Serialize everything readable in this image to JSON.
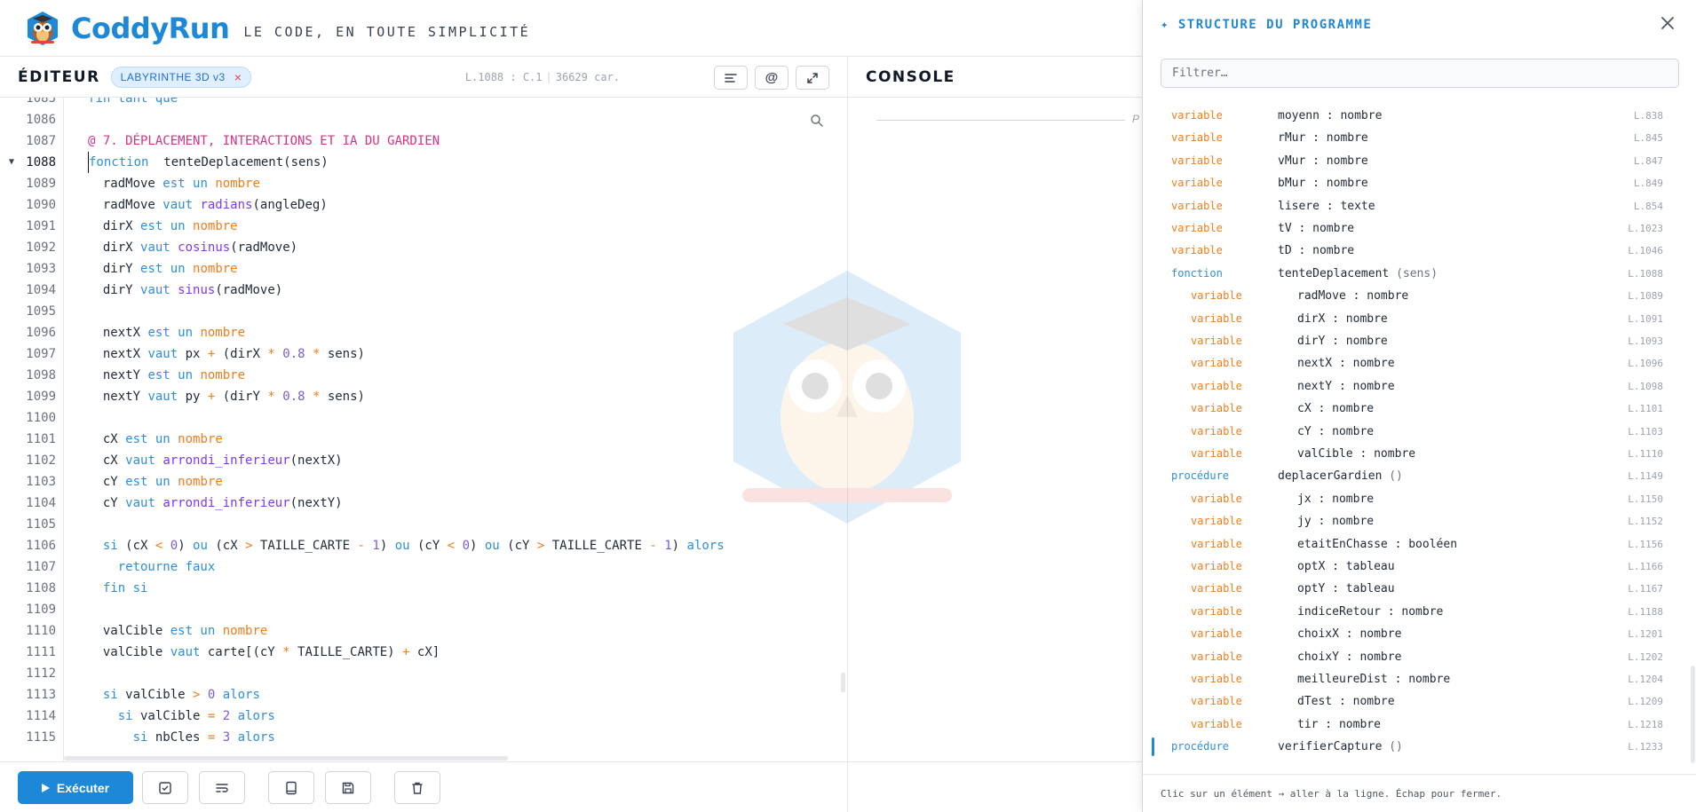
{
  "header": {
    "brand": "CoddyRun",
    "tagline": "LE CODE, EN TOUTE SIMPLICITÉ"
  },
  "editor": {
    "title": "ÉDITEUR",
    "file_tab": "LABYRINTHE 3D v3",
    "cursor_pos": "L.1088 : C.1",
    "char_count": "36629 car.",
    "lines": [
      {
        "n": "1085",
        "tokens": [
          [
            "kw",
            "fin tant que"
          ]
        ]
      },
      {
        "n": "1086",
        "tokens": []
      },
      {
        "n": "1087",
        "tokens": [
          [
            "cmt",
            "@ 7. DÉPLACEMENT, INTERACTIONS ET IA DU GARDIEN"
          ]
        ]
      },
      {
        "n": "1088",
        "active": true,
        "fold": true,
        "tokens": [
          [
            "kw",
            "fonction"
          ],
          [
            "",
            "  "
          ],
          [
            "",
            "tenteDeplacement(sens)"
          ]
        ]
      },
      {
        "n": "1089",
        "tokens": [
          [
            "",
            "  radMove "
          ],
          [
            "kw",
            "est un "
          ],
          [
            "ty",
            "nombre"
          ]
        ]
      },
      {
        "n": "1090",
        "tokens": [
          [
            "",
            "  radMove "
          ],
          [
            "kw",
            "vaut "
          ],
          [
            "fn",
            "radians"
          ],
          [
            "",
            "(angleDeg)"
          ]
        ]
      },
      {
        "n": "1091",
        "tokens": [
          [
            "",
            "  dirX "
          ],
          [
            "kw",
            "est un "
          ],
          [
            "ty",
            "nombre"
          ]
        ]
      },
      {
        "n": "1092",
        "tokens": [
          [
            "",
            "  dirX "
          ],
          [
            "kw",
            "vaut "
          ],
          [
            "fn",
            "cosinus"
          ],
          [
            "",
            "(radMove)"
          ]
        ]
      },
      {
        "n": "1093",
        "tokens": [
          [
            "",
            "  dirY "
          ],
          [
            "kw",
            "est un "
          ],
          [
            "ty",
            "nombre"
          ]
        ]
      },
      {
        "n": "1094",
        "tokens": [
          [
            "",
            "  dirY "
          ],
          [
            "kw",
            "vaut "
          ],
          [
            "fn",
            "sinus"
          ],
          [
            "",
            "(radMove)"
          ]
        ]
      },
      {
        "n": "1095",
        "tokens": []
      },
      {
        "n": "1096",
        "tokens": [
          [
            "",
            "  nextX "
          ],
          [
            "kw",
            "est un "
          ],
          [
            "ty",
            "nombre"
          ]
        ]
      },
      {
        "n": "1097",
        "tokens": [
          [
            "",
            "  nextX "
          ],
          [
            "kw",
            "vaut "
          ],
          [
            "",
            "px "
          ],
          [
            "op",
            "+"
          ],
          [
            "",
            " (dirX "
          ],
          [
            "op",
            "*"
          ],
          [
            "",
            " "
          ],
          [
            "num",
            "0.8"
          ],
          [
            "",
            " "
          ],
          [
            "op",
            "*"
          ],
          [
            "",
            " sens)"
          ]
        ]
      },
      {
        "n": "1098",
        "tokens": [
          [
            "",
            "  nextY "
          ],
          [
            "kw",
            "est un "
          ],
          [
            "ty",
            "nombre"
          ]
        ]
      },
      {
        "n": "1099",
        "tokens": [
          [
            "",
            "  nextY "
          ],
          [
            "kw",
            "vaut "
          ],
          [
            "",
            "py "
          ],
          [
            "op",
            "+"
          ],
          [
            "",
            " (dirY "
          ],
          [
            "op",
            "*"
          ],
          [
            "",
            " "
          ],
          [
            "num",
            "0.8"
          ],
          [
            "",
            " "
          ],
          [
            "op",
            "*"
          ],
          [
            "",
            " sens)"
          ]
        ]
      },
      {
        "n": "1100",
        "tokens": []
      },
      {
        "n": "1101",
        "tokens": [
          [
            "",
            "  cX "
          ],
          [
            "kw",
            "est un "
          ],
          [
            "ty",
            "nombre"
          ]
        ]
      },
      {
        "n": "1102",
        "tokens": [
          [
            "",
            "  cX "
          ],
          [
            "kw",
            "vaut "
          ],
          [
            "fn",
            "arrondi_inferieur"
          ],
          [
            "",
            "(nextX)"
          ]
        ]
      },
      {
        "n": "1103",
        "tokens": [
          [
            "",
            "  cY "
          ],
          [
            "kw",
            "est un "
          ],
          [
            "ty",
            "nombre"
          ]
        ]
      },
      {
        "n": "1104",
        "tokens": [
          [
            "",
            "  cY "
          ],
          [
            "kw",
            "vaut "
          ],
          [
            "fn",
            "arrondi_inferieur"
          ],
          [
            "",
            "(nextY)"
          ]
        ]
      },
      {
        "n": "1105",
        "tokens": []
      },
      {
        "n": "1106",
        "tokens": [
          [
            "",
            "  "
          ],
          [
            "kw",
            "si"
          ],
          [
            "",
            " (cX "
          ],
          [
            "op",
            "<"
          ],
          [
            "",
            " "
          ],
          [
            "num",
            "0"
          ],
          [
            "",
            ") "
          ],
          [
            "kw",
            "ou"
          ],
          [
            "",
            " (cX "
          ],
          [
            "op",
            ">"
          ],
          [
            "",
            " TAILLE_CARTE "
          ],
          [
            "op",
            "-"
          ],
          [
            "",
            " "
          ],
          [
            "num",
            "1"
          ],
          [
            "",
            ") "
          ],
          [
            "kw",
            "ou"
          ],
          [
            "",
            " (cY "
          ],
          [
            "op",
            "<"
          ],
          [
            "",
            " "
          ],
          [
            "num",
            "0"
          ],
          [
            "",
            ") "
          ],
          [
            "kw",
            "ou"
          ],
          [
            "",
            " (cY "
          ],
          [
            "op",
            ">"
          ],
          [
            "",
            " TAILLE_CARTE "
          ],
          [
            "op",
            "-"
          ],
          [
            "",
            " "
          ],
          [
            "num",
            "1"
          ],
          [
            "",
            ") "
          ],
          [
            "kw",
            "alors"
          ]
        ]
      },
      {
        "n": "1107",
        "tokens": [
          [
            "",
            "    "
          ],
          [
            "kw",
            "retourne faux"
          ]
        ]
      },
      {
        "n": "1108",
        "tokens": [
          [
            "",
            "  "
          ],
          [
            "kw",
            "fin si"
          ]
        ]
      },
      {
        "n": "1109",
        "tokens": []
      },
      {
        "n": "1110",
        "tokens": [
          [
            "",
            "  valCible "
          ],
          [
            "kw",
            "est un "
          ],
          [
            "ty",
            "nombre"
          ]
        ]
      },
      {
        "n": "1111",
        "tokens": [
          [
            "",
            "  valCible "
          ],
          [
            "kw",
            "vaut "
          ],
          [
            "",
            "carte[(cY "
          ],
          [
            "op",
            "*"
          ],
          [
            "",
            " TAILLE_CARTE) "
          ],
          [
            "op",
            "+"
          ],
          [
            "",
            " cX]"
          ]
        ]
      },
      {
        "n": "1112",
        "tokens": []
      },
      {
        "n": "1113",
        "tokens": [
          [
            "",
            "  "
          ],
          [
            "kw",
            "si"
          ],
          [
            "",
            " valCible "
          ],
          [
            "op",
            ">"
          ],
          [
            "",
            " "
          ],
          [
            "num",
            "0"
          ],
          [
            "",
            " "
          ],
          [
            "kw",
            "alors"
          ]
        ]
      },
      {
        "n": "1114",
        "tokens": [
          [
            "",
            "    "
          ],
          [
            "kw",
            "si"
          ],
          [
            "",
            " valCible "
          ],
          [
            "op",
            "="
          ],
          [
            "",
            " "
          ],
          [
            "num",
            "2"
          ],
          [
            "",
            " "
          ],
          [
            "kw",
            "alors"
          ]
        ]
      },
      {
        "n": "1115",
        "tokens": [
          [
            "",
            "      "
          ],
          [
            "kw",
            "si"
          ],
          [
            "",
            " nbCles "
          ],
          [
            "op",
            "="
          ],
          [
            "",
            " "
          ],
          [
            "num",
            "3"
          ],
          [
            "",
            " "
          ],
          [
            "kw",
            "alors"
          ]
        ]
      }
    ]
  },
  "console": {
    "title": "CONSOLE",
    "prompt_hint": "P"
  },
  "toolbar": {
    "run_label": "Exécuter"
  },
  "structure": {
    "title": "✦ STRUCTURE DU PROGRAMME",
    "filter_placeholder": "Filtrer…",
    "footer": "Clic sur un élément → aller à la ligne. Échap pour fermer.",
    "items": [
      {
        "kind": "variable",
        "name": "moyenn",
        "type": "nombre",
        "line": "L.838",
        "depth": 0
      },
      {
        "kind": "variable",
        "name": "rMur",
        "type": "nombre",
        "line": "L.845",
        "depth": 0
      },
      {
        "kind": "variable",
        "name": "vMur",
        "type": "nombre",
        "line": "L.847",
        "depth": 0
      },
      {
        "kind": "variable",
        "name": "bMur",
        "type": "nombre",
        "line": "L.849",
        "depth": 0
      },
      {
        "kind": "variable",
        "name": "lisere",
        "type": "texte",
        "line": "L.854",
        "depth": 0
      },
      {
        "kind": "variable",
        "name": "tV",
        "type": "nombre",
        "line": "L.1023",
        "depth": 0
      },
      {
        "kind": "variable",
        "name": "tD",
        "type": "nombre",
        "line": "L.1046",
        "depth": 0
      },
      {
        "kind": "fonction",
        "name": "tenteDeplacement",
        "params": "(sens)",
        "line": "L.1088",
        "depth": 0
      },
      {
        "kind": "variable",
        "name": "radMove",
        "type": "nombre",
        "line": "L.1089",
        "depth": 1
      },
      {
        "kind": "variable",
        "name": "dirX",
        "type": "nombre",
        "line": "L.1091",
        "depth": 1
      },
      {
        "kind": "variable",
        "name": "dirY",
        "type": "nombre",
        "line": "L.1093",
        "depth": 1
      },
      {
        "kind": "variable",
        "name": "nextX",
        "type": "nombre",
        "line": "L.1096",
        "depth": 1
      },
      {
        "kind": "variable",
        "name": "nextY",
        "type": "nombre",
        "line": "L.1098",
        "depth": 1
      },
      {
        "kind": "variable",
        "name": "cX",
        "type": "nombre",
        "line": "L.1101",
        "depth": 1
      },
      {
        "kind": "variable",
        "name": "cY",
        "type": "nombre",
        "line": "L.1103",
        "depth": 1
      },
      {
        "kind": "variable",
        "name": "valCible",
        "type": "nombre",
        "line": "L.1110",
        "depth": 1
      },
      {
        "kind": "procédure",
        "name": "deplacerGardien",
        "params": "()",
        "line": "L.1149",
        "depth": 0
      },
      {
        "kind": "variable",
        "name": "jx",
        "type": "nombre",
        "line": "L.1150",
        "depth": 1
      },
      {
        "kind": "variable",
        "name": "jy",
        "type": "nombre",
        "line": "L.1152",
        "depth": 1
      },
      {
        "kind": "variable",
        "name": "etaitEnChasse",
        "type": "booléen",
        "line": "L.1156",
        "depth": 1
      },
      {
        "kind": "variable",
        "name": "optX",
        "type": "tableau",
        "line": "L.1166",
        "depth": 1
      },
      {
        "kind": "variable",
        "name": "optY",
        "type": "tableau",
        "line": "L.1167",
        "depth": 1
      },
      {
        "kind": "variable",
        "name": "indiceRetour",
        "type": "nombre",
        "line": "L.1188",
        "depth": 1
      },
      {
        "kind": "variable",
        "name": "choixX",
        "type": "nombre",
        "line": "L.1201",
        "depth": 1
      },
      {
        "kind": "variable",
        "name": "choixY",
        "type": "nombre",
        "line": "L.1202",
        "depth": 1
      },
      {
        "kind": "variable",
        "name": "meilleureDist",
        "type": "nombre",
        "line": "L.1204",
        "depth": 1
      },
      {
        "kind": "variable",
        "name": "dTest",
        "type": "nombre",
        "line": "L.1209",
        "depth": 1
      },
      {
        "kind": "variable",
        "name": "tir",
        "type": "nombre",
        "line": "L.1218",
        "depth": 1
      },
      {
        "kind": "procédure",
        "name": "verifierCapture",
        "params": "()",
        "line": "L.1233",
        "depth": 0,
        "selected": true
      }
    ]
  }
}
